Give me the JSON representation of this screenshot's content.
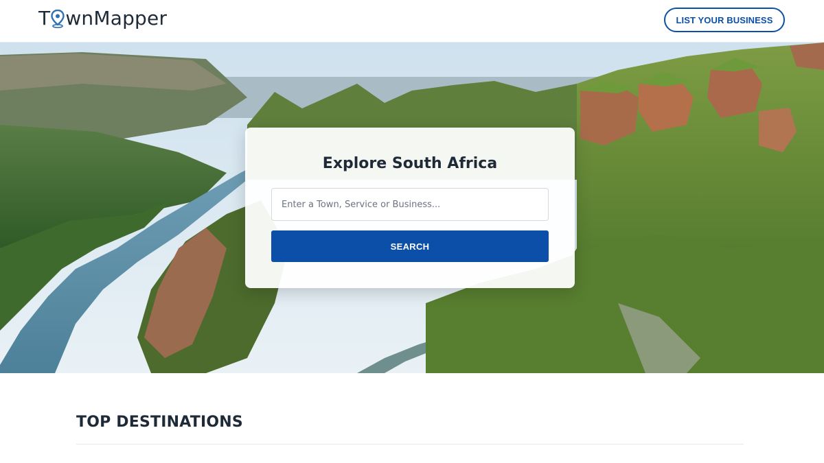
{
  "header": {
    "logo_text_before": "T",
    "logo_text_after": "wnMapper",
    "logo_icon": "map-pin-icon",
    "list_business_label": "LIST YOUR BUSINESS"
  },
  "hero": {
    "title": "Explore South Africa",
    "search_placeholder": "Enter a Town, Service or Business...",
    "search_value": "",
    "search_button_label": "SEARCH"
  },
  "sections": {
    "top_destinations_title": "TOP DESTINATIONS"
  },
  "colors": {
    "brand_blue": "#0b4fa8",
    "text_dark": "#1f2a38",
    "map_pin_blue": "#2f6fb3"
  }
}
